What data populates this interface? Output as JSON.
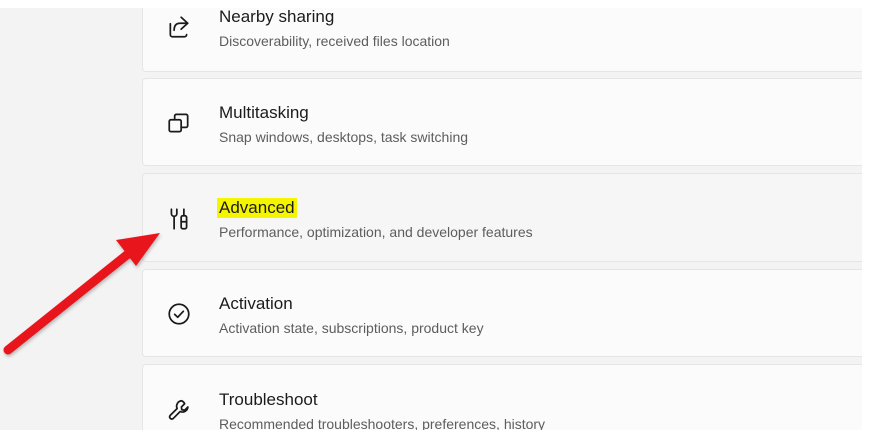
{
  "settings_items": [
    {
      "id": "nearby-sharing",
      "title": "Nearby sharing",
      "subtitle": "Discoverability, received files location",
      "icon": "share-icon"
    },
    {
      "id": "multitasking",
      "title": "Multitasking",
      "subtitle": "Snap windows, desktops, task switching",
      "icon": "multitasking-icon"
    },
    {
      "id": "advanced",
      "title": "Advanced",
      "subtitle": "Performance, optimization, and developer features",
      "icon": "advanced-tools-icon",
      "highlighted": true
    },
    {
      "id": "activation",
      "title": "Activation",
      "subtitle": "Activation state, subscriptions, product key",
      "icon": "check-circle-icon"
    },
    {
      "id": "troubleshoot",
      "title": "Troubleshoot",
      "subtitle": "Recommended troubleshooters, preferences, history",
      "icon": "wrench-icon"
    }
  ],
  "annotation": {
    "arrow_color": "#e8141b",
    "highlight_color": "#f5f500"
  }
}
